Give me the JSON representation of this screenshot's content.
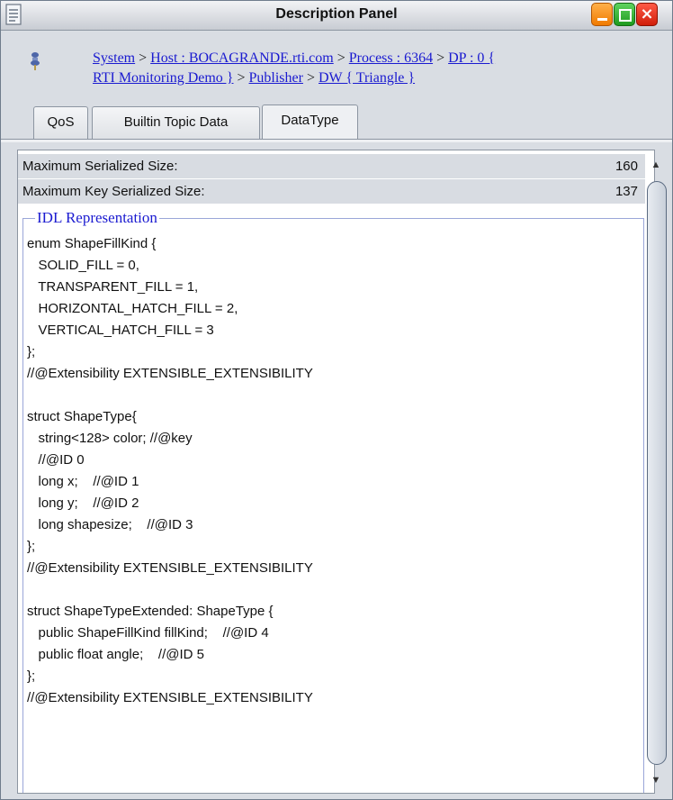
{
  "window": {
    "title": "Description Panel"
  },
  "breadcrumb": {
    "items": [
      {
        "label": "System",
        "link": true
      },
      {
        "label": " > ",
        "link": false
      },
      {
        "label": "Host : BOCAGRANDE.rti.com",
        "link": true
      },
      {
        "label": " > ",
        "link": false
      },
      {
        "label": "Process : 6364",
        "link": true
      },
      {
        "label": " > ",
        "link": false
      },
      {
        "label": "DP : 0 {",
        "link": true
      },
      {
        "label": "RTI Monitoring Demo }",
        "link": true
      },
      {
        "label": " > ",
        "link": false
      },
      {
        "label": "Publisher",
        "link": true
      },
      {
        "label": " > ",
        "link": false
      },
      {
        "label": "DW { Triangle }",
        "link": true
      }
    ]
  },
  "tabs": [
    {
      "label": "QoS",
      "active": false
    },
    {
      "label": "Builtin Topic Data",
      "active": false
    },
    {
      "label": "DataType",
      "active": true
    }
  ],
  "properties": [
    {
      "label": "Maximum Serialized Size:",
      "value": "160"
    },
    {
      "label": "Maximum Key Serialized Size:",
      "value": "137"
    }
  ],
  "idl": {
    "legend": "IDL Representation",
    "code": "enum ShapeFillKind {\n   SOLID_FILL = 0,\n   TRANSPARENT_FILL = 1,\n   HORIZONTAL_HATCH_FILL = 2,\n   VERTICAL_HATCH_FILL = 3\n};\n//@Extensibility EXTENSIBLE_EXTENSIBILITY\n\nstruct ShapeType{\n   string<128> color; //@key\n   //@ID 0\n   long x;    //@ID 1\n   long y;    //@ID 2\n   long shapesize;    //@ID 3\n};\n//@Extensibility EXTENSIBLE_EXTENSIBILITY\n\nstruct ShapeTypeExtended: ShapeType {\n   public ShapeFillKind fillKind;    //@ID 4\n   public float angle;    //@ID 5\n};\n//@Extensibility EXTENSIBLE_EXTENSIBILITY"
  },
  "icons": {
    "title": "document-icon",
    "breadcrumb": "datawriter-icon"
  }
}
